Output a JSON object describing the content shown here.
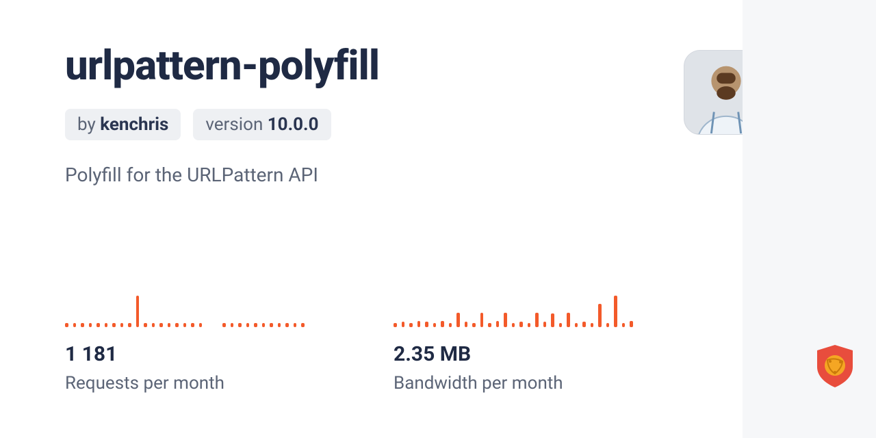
{
  "package": {
    "name": "urlpattern-polyfill",
    "by_prefix": "by ",
    "author": "kenchris",
    "version_prefix": "version ",
    "version": "10.0.0",
    "description": "Polyfill for the URLPattern API"
  },
  "chart_data": [
    {
      "type": "bar",
      "title": "Requests per month",
      "value_label": "1 181",
      "values": [
        4,
        4,
        4,
        4,
        4,
        4,
        4,
        4,
        4,
        30,
        4,
        4,
        4,
        4,
        4,
        4,
        4,
        4,
        0,
        0,
        4,
        4,
        4,
        4,
        4,
        4,
        4,
        4,
        4,
        4,
        4
      ],
      "color": "#f35a2a"
    },
    {
      "type": "bar",
      "title": "Bandwidth per month",
      "value_label": "2.35 MB",
      "values": [
        4,
        5,
        4,
        6,
        5,
        4,
        6,
        4,
        14,
        5,
        4,
        14,
        4,
        6,
        14,
        4,
        5,
        4,
        14,
        5,
        13,
        4,
        14,
        4,
        5,
        4,
        22,
        4,
        30,
        4,
        6
      ],
      "color": "#f35a2a"
    }
  ],
  "icons": {
    "avatar": "author-avatar",
    "logo": "jsdelivr-shield"
  }
}
